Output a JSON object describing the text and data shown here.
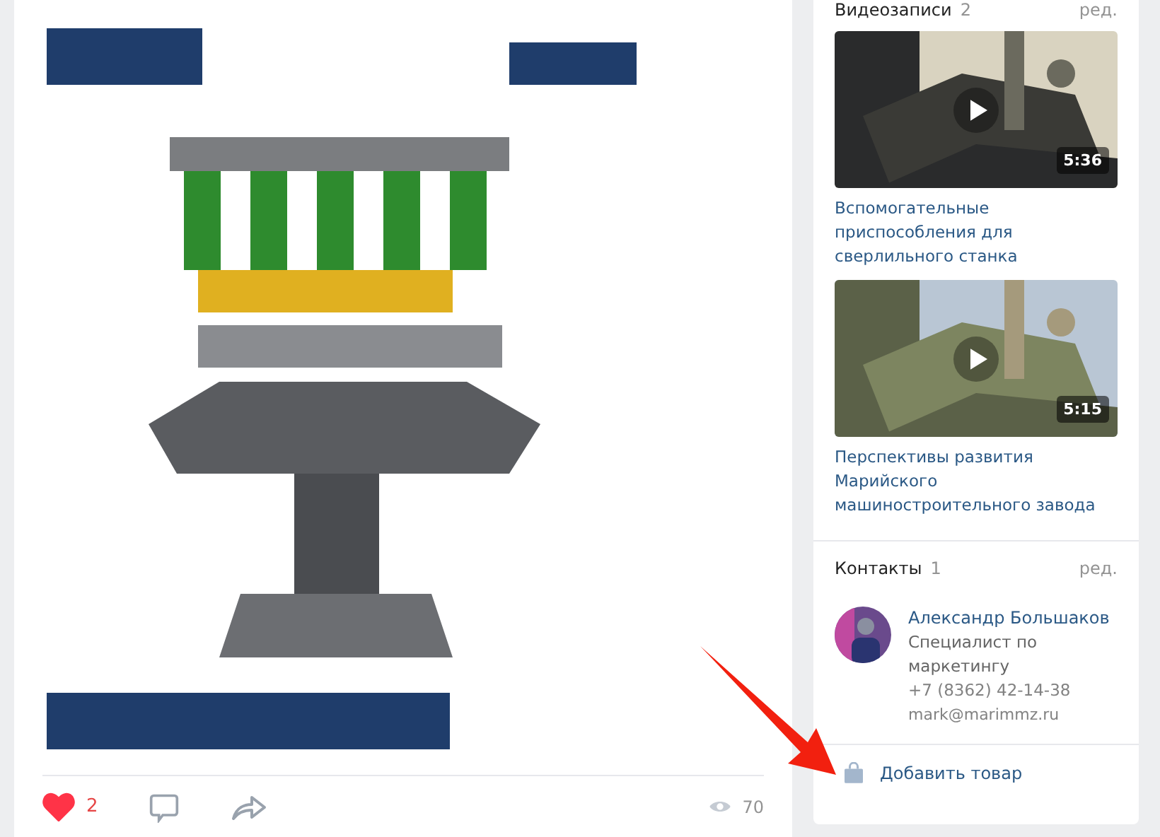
{
  "post": {
    "actions": {
      "liked": true,
      "likes": "2",
      "views": "70"
    }
  },
  "videos": {
    "title": "Видеозаписи",
    "count": "2",
    "edit": "ред.",
    "items": [
      {
        "title": "Вспомогательные приспособления для сверлильного станка",
        "duration": "5:36"
      },
      {
        "title": "Перспективы развития Марийского машиностроительного завода",
        "duration": "5:15"
      }
    ]
  },
  "contacts": {
    "title": "Контакты",
    "count": "1",
    "edit": "ред.",
    "items": [
      {
        "name": "Александр Большаков",
        "role": "Специалист по маркетингу",
        "phone": "+7 (8362) 42-14-38",
        "email": "mark@marimmz.ru"
      }
    ]
  },
  "add_product": "Добавить товар"
}
